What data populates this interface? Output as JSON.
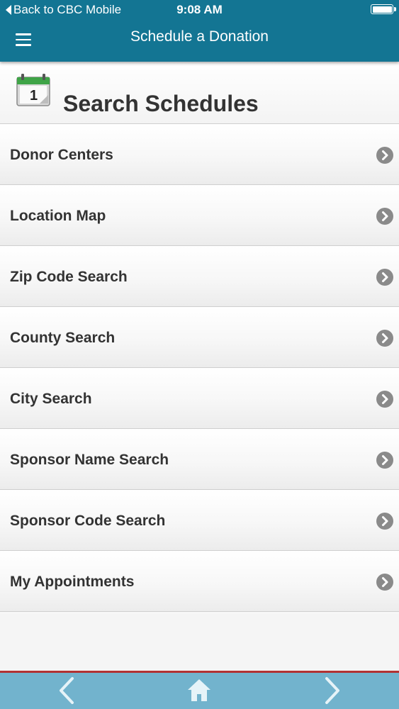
{
  "status_bar": {
    "back_label": "Back to CBC Mobile",
    "time": "9:08 AM"
  },
  "header": {
    "title": "Schedule a Donation",
    "menu_icon": "hamburger-menu-icon",
    "color": "#137593"
  },
  "section": {
    "title": "Search Schedules",
    "icon": "calendar-icon",
    "calendar_day": "1"
  },
  "menu_items": [
    {
      "label": "Donor Centers"
    },
    {
      "label": "Location Map"
    },
    {
      "label": "Zip Code Search"
    },
    {
      "label": "County Search"
    },
    {
      "label": "City Search"
    },
    {
      "label": "Sponsor Name Search"
    },
    {
      "label": "Sponsor Code Search"
    },
    {
      "label": "My Appointments"
    }
  ],
  "footer": {
    "icons": [
      "back-arrow-icon",
      "home-icon",
      "forward-arrow-icon"
    ],
    "color": "#72b3cd",
    "accent_line": "#b23232"
  }
}
